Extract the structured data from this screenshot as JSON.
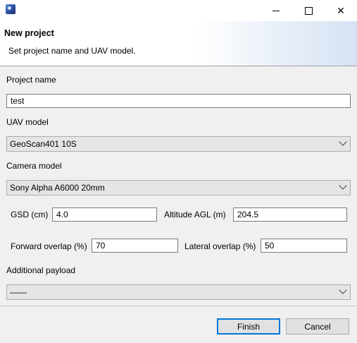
{
  "window": {
    "icon": "app-icon",
    "controls": {
      "minimize": "minimize-icon",
      "maximize": "maximize-icon",
      "close": "✕"
    }
  },
  "header": {
    "title": "New project",
    "subtitle": "Set project name and UAV model."
  },
  "form": {
    "project_name": {
      "label": "Project name",
      "value": "test"
    },
    "uav_model": {
      "label": "UAV model",
      "selected": "GeoScan401 10S"
    },
    "camera_model": {
      "label": "Camera model",
      "selected": "Sony Alpha A6000 20mm"
    },
    "gsd": {
      "label": "GSD (cm)",
      "value": "4.0"
    },
    "altitude": {
      "label": "Altitude AGL (m)",
      "value": "204.5"
    },
    "forward_overlap": {
      "label": "Forward overlap (%)",
      "value": "70"
    },
    "lateral_overlap": {
      "label": "Lateral overlap (%)",
      "value": "50"
    },
    "additional_payload": {
      "label": "Additional payload",
      "selected": "——"
    }
  },
  "buttons": {
    "finish": "Finish",
    "cancel": "Cancel"
  },
  "colors": {
    "accent": "#0078d7",
    "background": "#f0f0f0"
  }
}
